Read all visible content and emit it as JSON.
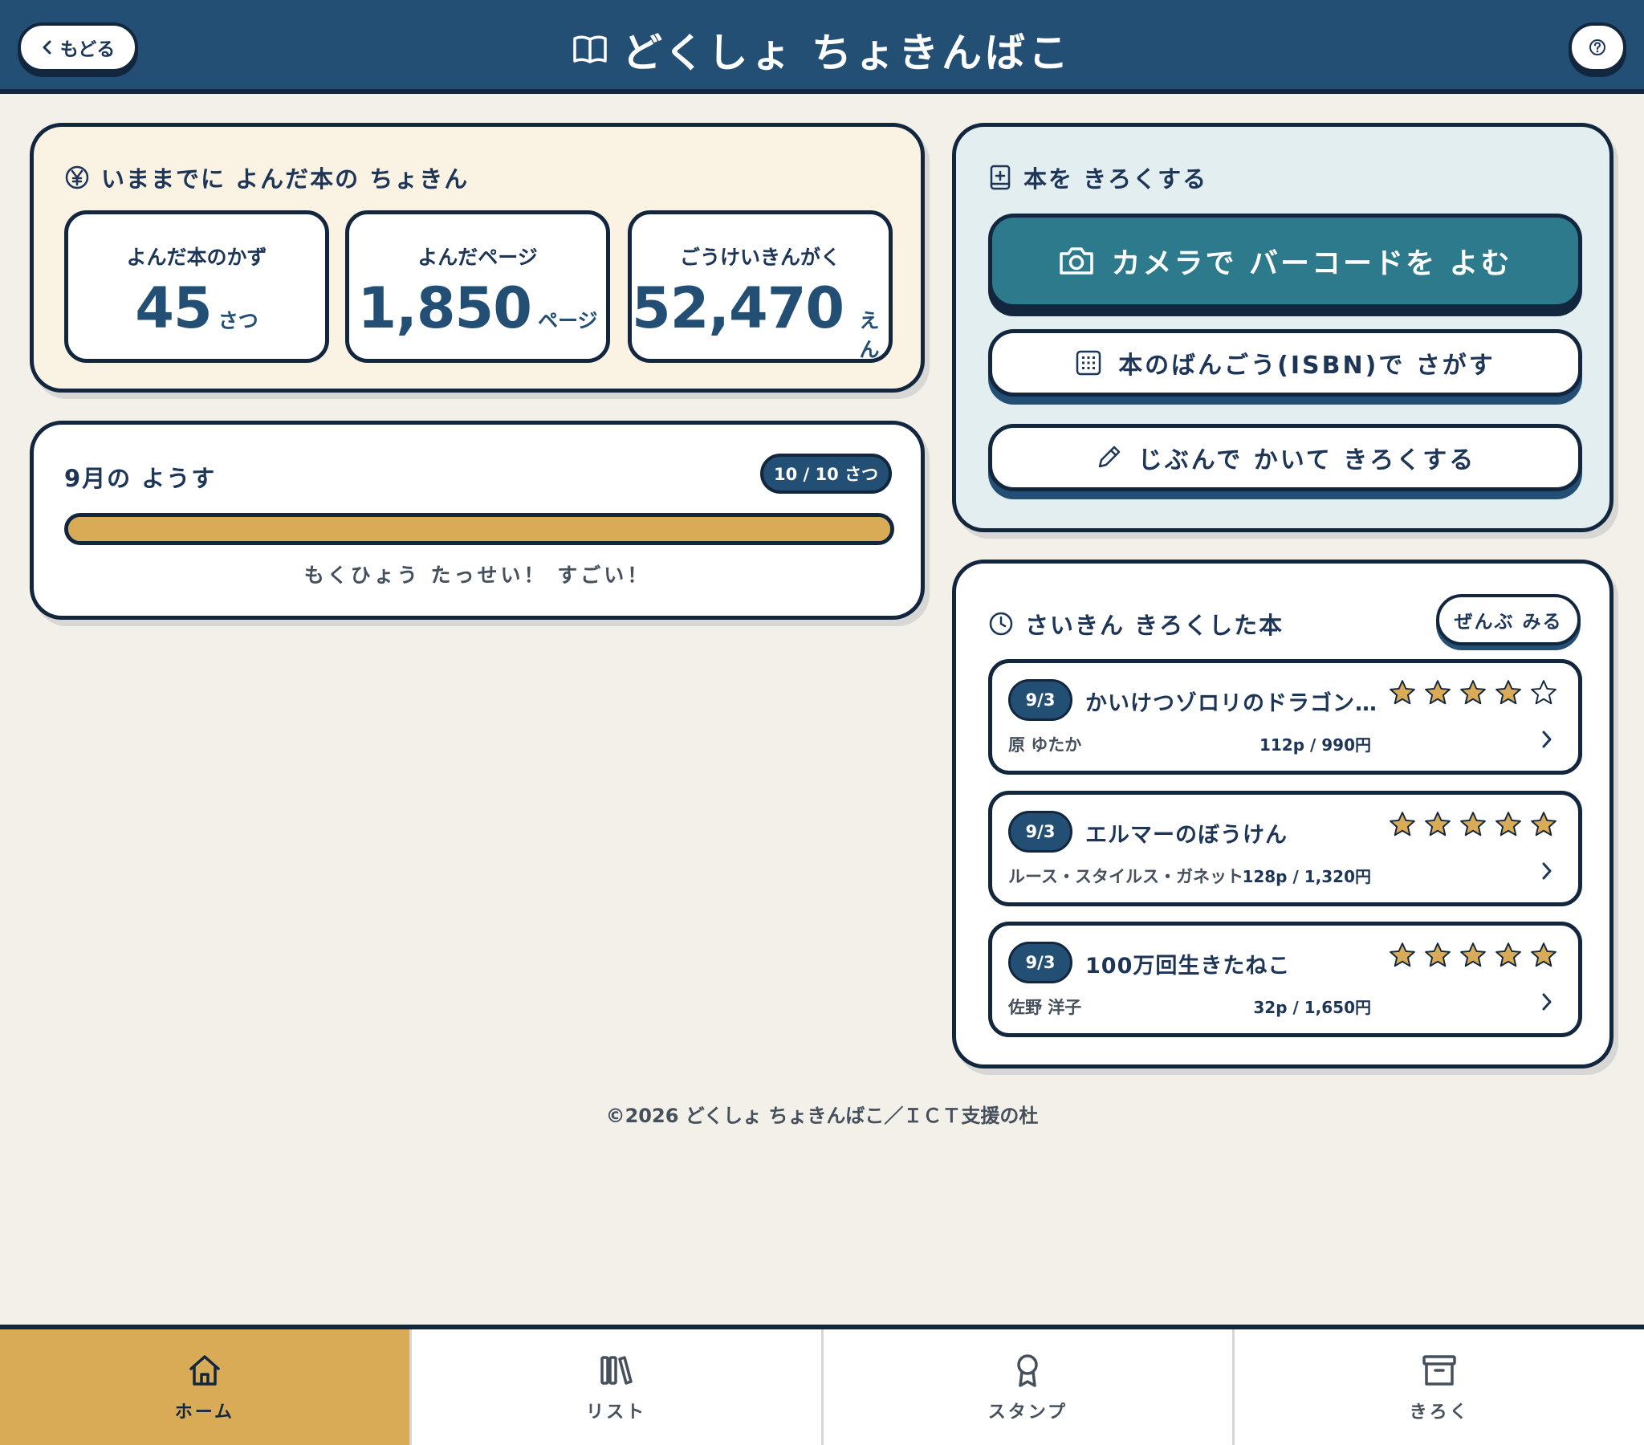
{
  "header": {
    "back_label": "もどる",
    "title": "どくしょ ちょきんばこ"
  },
  "savings": {
    "title": "いままでに よんだ本の ちょきん",
    "stats": [
      {
        "label": "よんだ本のかず",
        "value": "45",
        "unit": "さつ"
      },
      {
        "label": "よんだページ",
        "value": "1,850",
        "unit": "ページ"
      },
      {
        "label": "ごうけいきんがく",
        "value": "52,470",
        "unit": "えん"
      }
    ]
  },
  "monthly": {
    "title": "9月の ようす",
    "badge": "10 / 10 さつ",
    "progress": 1.0,
    "message": "もくひょう たっせい！ すごい！"
  },
  "register": {
    "title": "本を きろくする",
    "camera_label": "カメラで バーコードを よむ",
    "isbn_label": "本のばんごう(ISBN)で さがす",
    "manual_label": "じぶんで かいて きろくする"
  },
  "recent": {
    "title": "さいきん きろくした本",
    "see_all": "ぜんぶ みる",
    "books": [
      {
        "date": "9/3",
        "title": "かいけつゾロリのドラゴンたいじ",
        "author": "原 ゆたか",
        "meta": "112p / 990円",
        "rating": 4
      },
      {
        "date": "9/3",
        "title": "エルマーのぼうけん",
        "author": "ルース・スタイルス・ガネット",
        "meta": "128p / 1,320円",
        "rating": 5
      },
      {
        "date": "9/3",
        "title": "100万回生きたねこ",
        "author": "佐野 洋子",
        "meta": "32p / 1,650円",
        "rating": 5
      }
    ]
  },
  "footer": "©2026 どくしょ ちょきんばこ／ＩＣＴ支援の杜",
  "nav": [
    {
      "label": "ホーム",
      "icon": "home-icon",
      "active": true
    },
    {
      "label": "リスト",
      "icon": "books-icon",
      "active": false
    },
    {
      "label": "スタンプ",
      "icon": "award-icon",
      "active": false
    },
    {
      "label": "きろく",
      "icon": "archive-icon",
      "active": false
    }
  ],
  "colors": {
    "navy": "#234f75",
    "dark": "#12263e",
    "gold": "#d9ab56",
    "teal": "#2d7a8c",
    "bg": "#f3f0ea"
  }
}
